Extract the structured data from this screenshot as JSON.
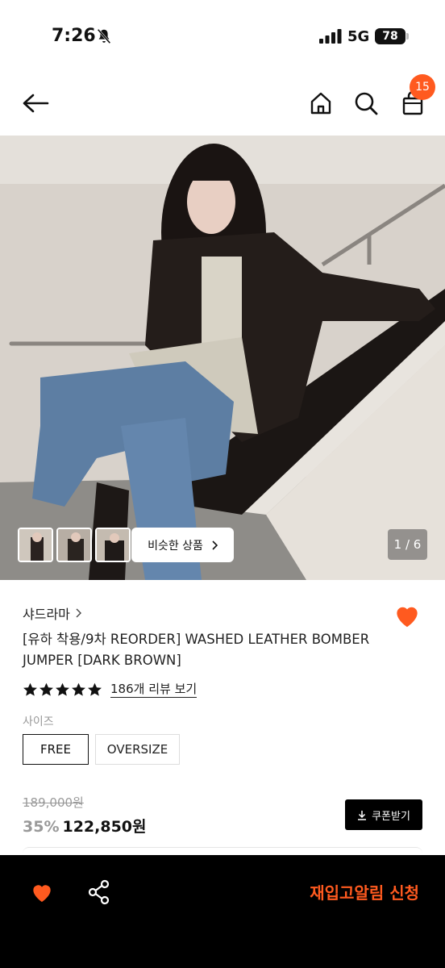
{
  "status": {
    "time": "7:26",
    "network": "5G",
    "battery": "78"
  },
  "header": {
    "cart_count": "15"
  },
  "gallery": {
    "similar_button_label": "비슷한 상품",
    "page_counter": "1 / 6"
  },
  "product": {
    "brand": "샤드라마",
    "title": "[유하 착용/9차 REORDER] WASHED LEATHER BOMBER JUMPER [DARK BROWN]",
    "rating_stars": 5,
    "review_link": "186개 리뷰 보기",
    "size_label": "사이즈",
    "sizes": [
      "FREE",
      "OVERSIZE"
    ],
    "selected_size": "FREE",
    "original_price": "189,000원",
    "discount": "35%",
    "sale_price": "122,850원",
    "coupon_button": "쿠폰받기"
  },
  "bottom_bar": {
    "restock_button": "재입고알림 신청"
  },
  "colors": {
    "accent": "#ff5a1f",
    "bottom_bar": "#000000"
  },
  "icons": [
    "bell-slash-icon",
    "signal-icon",
    "back-arrow-icon",
    "home-icon",
    "search-icon",
    "shopping-bag-icon",
    "chevron-right-icon",
    "heart-icon",
    "star-icon",
    "download-icon",
    "share-icon"
  ]
}
